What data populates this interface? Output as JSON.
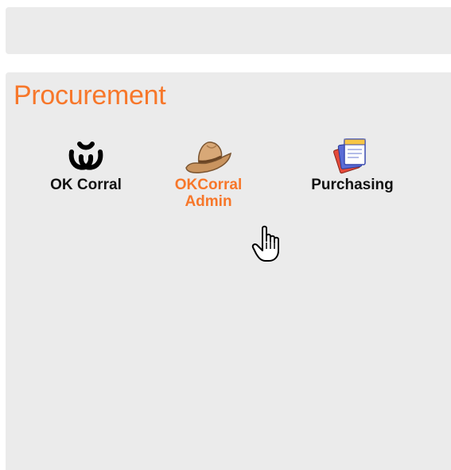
{
  "section": {
    "title": "Procurement"
  },
  "apps": [
    {
      "label": "OK Corral",
      "icon": "brand-horseshoe-icon"
    },
    {
      "label": "OKCorral\nAdmin",
      "icon": "cowboy-hat-icon",
      "state": "hover"
    },
    {
      "label": "Purchasing",
      "icon": "documents-stack-icon"
    }
  ],
  "colors": {
    "accent": "#f7772a",
    "panel": "#ebebeb",
    "text": "#111111"
  }
}
